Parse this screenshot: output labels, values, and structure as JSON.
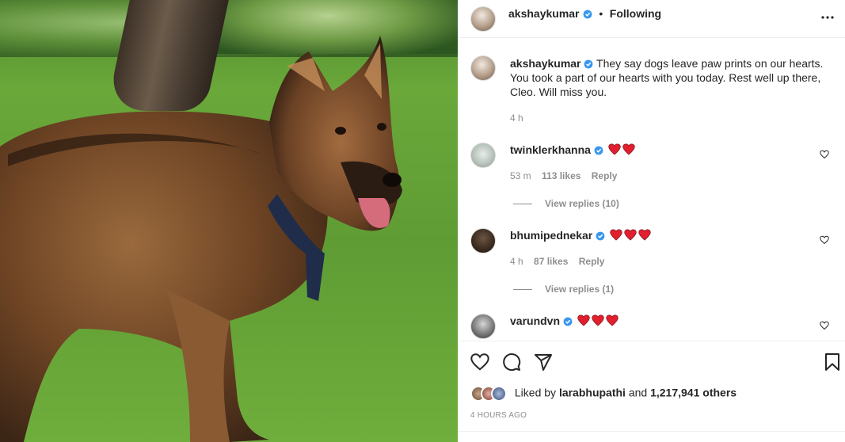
{
  "post": {
    "author": "akshaykumar",
    "follow_state": "Following",
    "separator": "•",
    "caption": "They say dogs leave paw prints on our hearts. You took a part of our hearts with you today. Rest well up there, Cleo. Will miss you.",
    "caption_time": "4 h",
    "liked_by_prefix": "Liked by",
    "liked_by_user": "larabhupathi",
    "liked_by_and": "and",
    "liked_by_count": "1,217,941 others",
    "time_ago": "4 HOURS AGO"
  },
  "comments": [
    {
      "user": "twinklerkhanna",
      "hearts": 2,
      "time": "53 m",
      "likes": "113 likes",
      "reply": "Reply",
      "view_replies": "View replies (10)"
    },
    {
      "user": "bhumipednekar",
      "hearts": 3,
      "time": "4 h",
      "likes": "87 likes",
      "reply": "Reply",
      "view_replies": "View replies (1)"
    },
    {
      "user": "varundvn",
      "hearts": 3
    }
  ],
  "icons": {
    "more": "more-options-icon",
    "like": "heart-icon",
    "comment": "comment-icon",
    "share": "paper-plane-icon",
    "save": "bookmark-icon",
    "verified": "verified-badge-icon"
  },
  "colors": {
    "verified": "#3897f0",
    "heart_red": "#ed4956",
    "muted": "#8e8e8e"
  }
}
